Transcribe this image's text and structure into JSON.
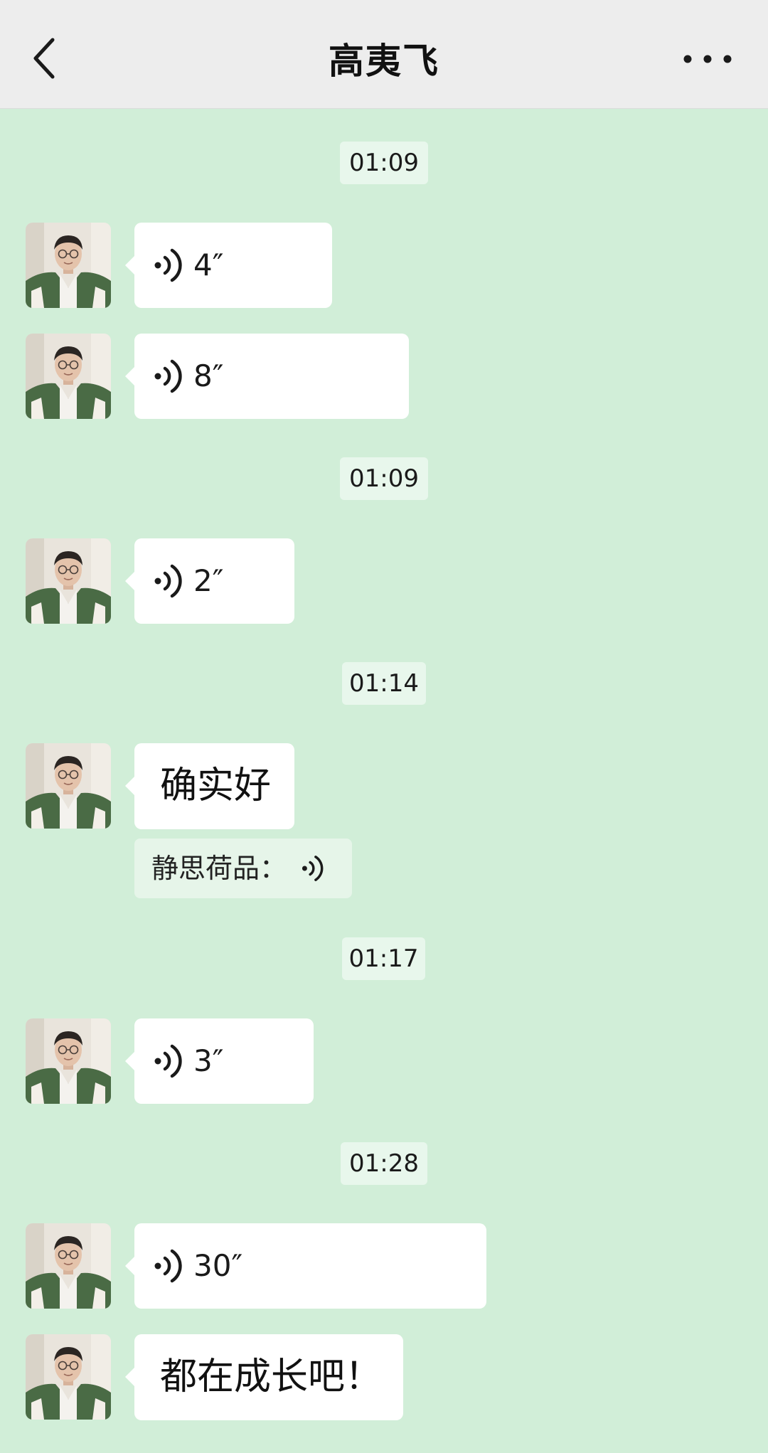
{
  "header": {
    "title": "高夷飞",
    "back_icon": "chevron-left-icon",
    "more_icon": "more-horizontal-icon"
  },
  "colors": {
    "background": "#d1eed8",
    "header_bg": "#ededed",
    "bubble_bg": "#ffffff",
    "timestamp_bg": "#e8f7ec",
    "quote_bg": "#e6f5e9"
  },
  "chat": {
    "timestamps": [
      "01:09",
      "01:09",
      "01:14",
      "01:17",
      "01:28"
    ],
    "messages": [
      {
        "type": "voice",
        "duration": "4″",
        "icon": "voice-wave-icon"
      },
      {
        "type": "voice",
        "duration": "8″",
        "icon": "voice-wave-icon"
      },
      {
        "type": "voice",
        "duration": "2″",
        "icon": "voice-wave-icon"
      },
      {
        "type": "text",
        "text": "确实好"
      },
      {
        "type": "voice",
        "duration": "3″",
        "icon": "voice-wave-icon"
      },
      {
        "type": "voice",
        "duration": "30″",
        "icon": "voice-wave-icon"
      },
      {
        "type": "text",
        "text": "都在成长吧！"
      }
    ],
    "quote": {
      "label": "静思荷品：",
      "icon": "voice-wave-icon"
    }
  }
}
